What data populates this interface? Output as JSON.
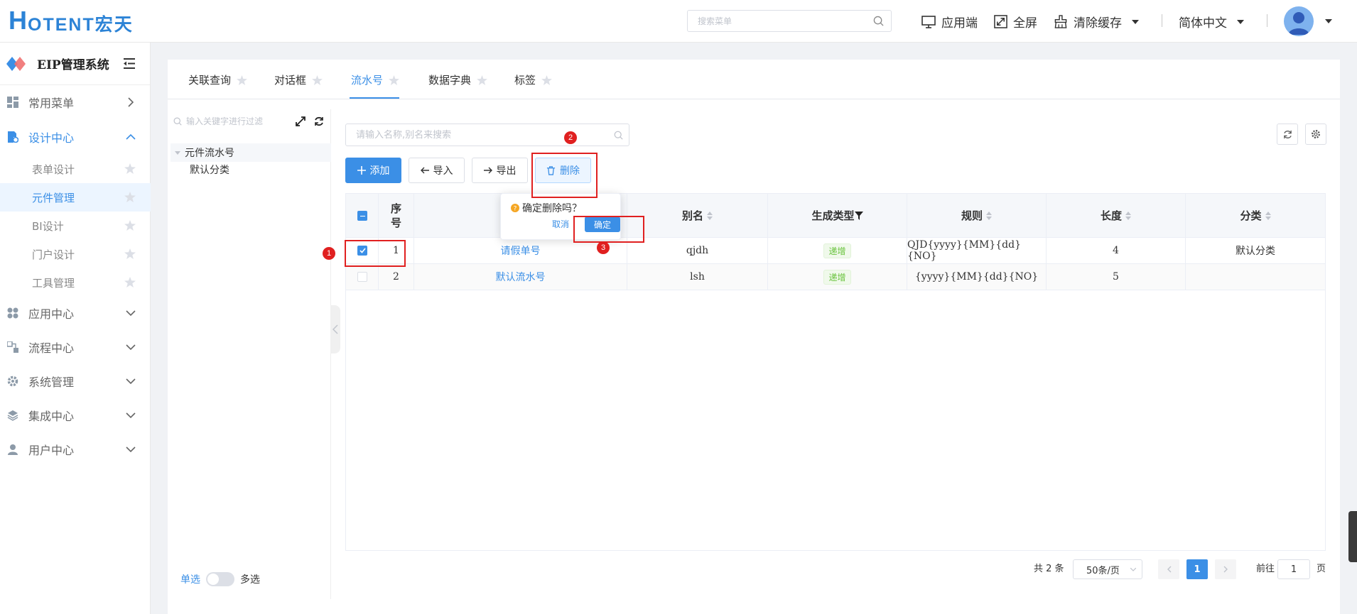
{
  "header": {
    "logo_big": "H",
    "logo_rest": "OTENT宏天",
    "search_placeholder": "搜索菜单",
    "app_label": "应用端",
    "fullscreen_label": "全屏",
    "clear_cache_label": "清除缓存",
    "language_label": "简体中文"
  },
  "sidebar": {
    "system_title": "EIP管理系统",
    "menus": {
      "common": "常用菜单",
      "design": "设计中心",
      "app": "应用中心",
      "flow": "流程中心",
      "system": "系统管理",
      "integration": "集成中心",
      "user": "用户中心"
    },
    "design_items": [
      "表单设计",
      "元件管理",
      "BI设计",
      "门户设计",
      "工具管理"
    ]
  },
  "tabs": [
    "关联查询",
    "对话框",
    "流水号",
    "数据字典",
    "标签"
  ],
  "active_tab": "流水号",
  "tree": {
    "search_placeholder": "输入关键字进行过滤",
    "root": "元件流水号",
    "child": "默认分类",
    "single_label": "单选",
    "multi_label": "多选"
  },
  "list": {
    "search_placeholder": "请输入名称,别名来搜索",
    "buttons": {
      "add": "添加",
      "import": "导入",
      "export": "导出",
      "delete": "删除"
    },
    "columns": {
      "seq": "序号",
      "alias": "别名",
      "gen_type": "生成类型",
      "rule": "规则",
      "length": "长度",
      "category": "分类"
    },
    "rows": [
      {
        "seq": "1",
        "name": "请假单号",
        "alias": "qjdh",
        "gen_type": "递增",
        "rule": "QJD{yyyy}{MM}{dd}{NO}",
        "length": "4",
        "category": "默认分类",
        "checked": true
      },
      {
        "seq": "2",
        "name": "默认流水号",
        "alias": "lsh",
        "gen_type": "递增",
        "rule": "{yyyy}{MM}{dd}{NO}",
        "length": "5",
        "category": "",
        "checked": false
      }
    ]
  },
  "popconfirm": {
    "message": "确定删除吗？",
    "cancel": "取消",
    "confirm": "确定"
  },
  "annotations": [
    "1",
    "2",
    "3"
  ],
  "pagination": {
    "total": "共 2 条",
    "page_size": "50条/页",
    "current": "1",
    "goto_label": "前往",
    "goto_value": "1",
    "page_suffix": "页"
  },
  "colors": {
    "primary": "#3b8fe6",
    "annotation_red": "#e02020",
    "tag_green": "#67c23a"
  }
}
